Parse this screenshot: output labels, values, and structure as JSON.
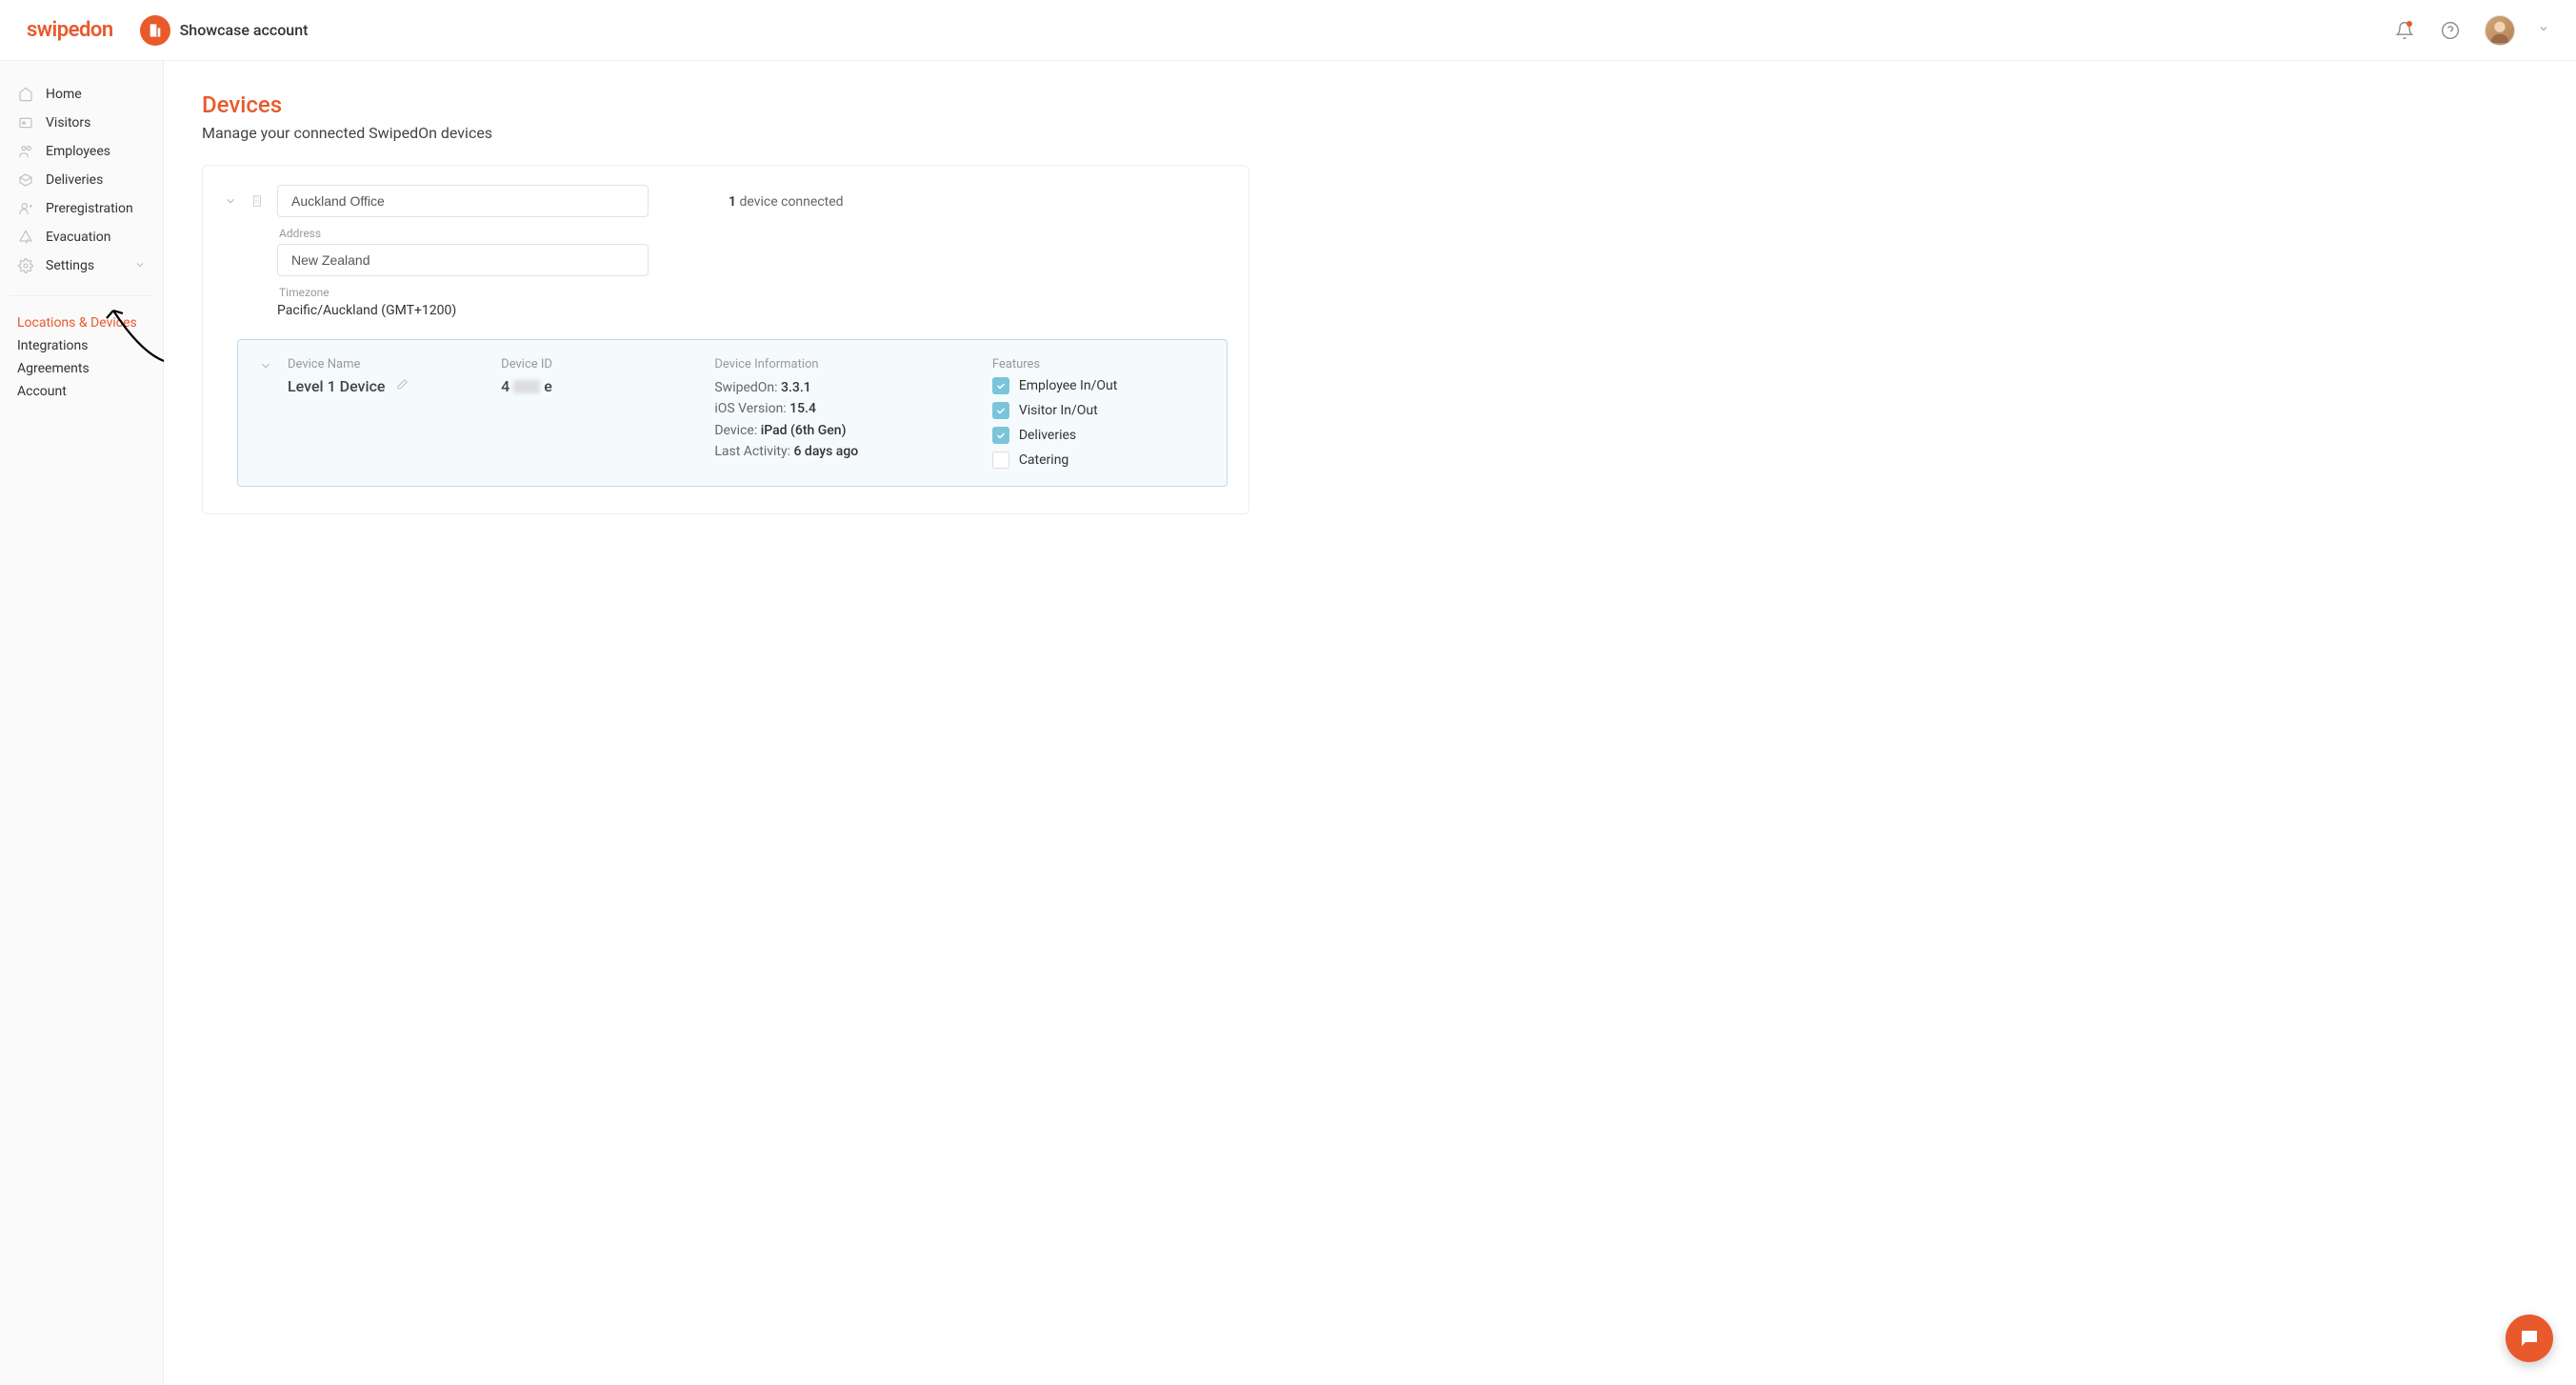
{
  "header": {
    "logo": "swipedon",
    "account_name": "Showcase account"
  },
  "sidebar": {
    "items": [
      {
        "label": "Home",
        "icon": "home-icon"
      },
      {
        "label": "Visitors",
        "icon": "visitors-icon"
      },
      {
        "label": "Employees",
        "icon": "employees-icon"
      },
      {
        "label": "Deliveries",
        "icon": "deliveries-icon"
      },
      {
        "label": "Preregistration",
        "icon": "preregistration-icon"
      },
      {
        "label": "Evacuation",
        "icon": "evacuation-icon"
      },
      {
        "label": "Settings",
        "icon": "settings-icon"
      }
    ],
    "subnav": [
      {
        "label": "Locations & Devices",
        "active": true
      },
      {
        "label": "Integrations",
        "active": false
      },
      {
        "label": "Agreements",
        "active": false
      },
      {
        "label": "Account",
        "active": false
      }
    ]
  },
  "page": {
    "title": "Devices",
    "subtitle": "Manage your connected SwipedOn devices"
  },
  "location": {
    "name": "Auckland Office",
    "address_label": "Address",
    "address": "New Zealand",
    "timezone_label": "Timezone",
    "timezone": "Pacific/Auckland (GMT+1200)",
    "device_count": "1",
    "device_count_suffix": " device connected"
  },
  "device": {
    "columns": {
      "name": "Device Name",
      "id": "Device ID",
      "info": "Device Information",
      "features": "Features"
    },
    "name": "Level 1 Device",
    "id_prefix": "4",
    "id_suffix": "e",
    "info": {
      "swipedon_label": "SwipedOn: ",
      "swipedon_value": "3.3.1",
      "ios_label": "iOS Version: ",
      "ios_value": "15.4",
      "device_label": "Device: ",
      "device_value": "iPad (6th Gen)",
      "activity_label": "Last Activity: ",
      "activity_value": "6 days ago"
    },
    "features": [
      {
        "label": "Employee In/Out",
        "checked": true
      },
      {
        "label": "Visitor In/Out",
        "checked": true
      },
      {
        "label": "Deliveries",
        "checked": true
      },
      {
        "label": "Catering",
        "checked": false
      }
    ]
  }
}
